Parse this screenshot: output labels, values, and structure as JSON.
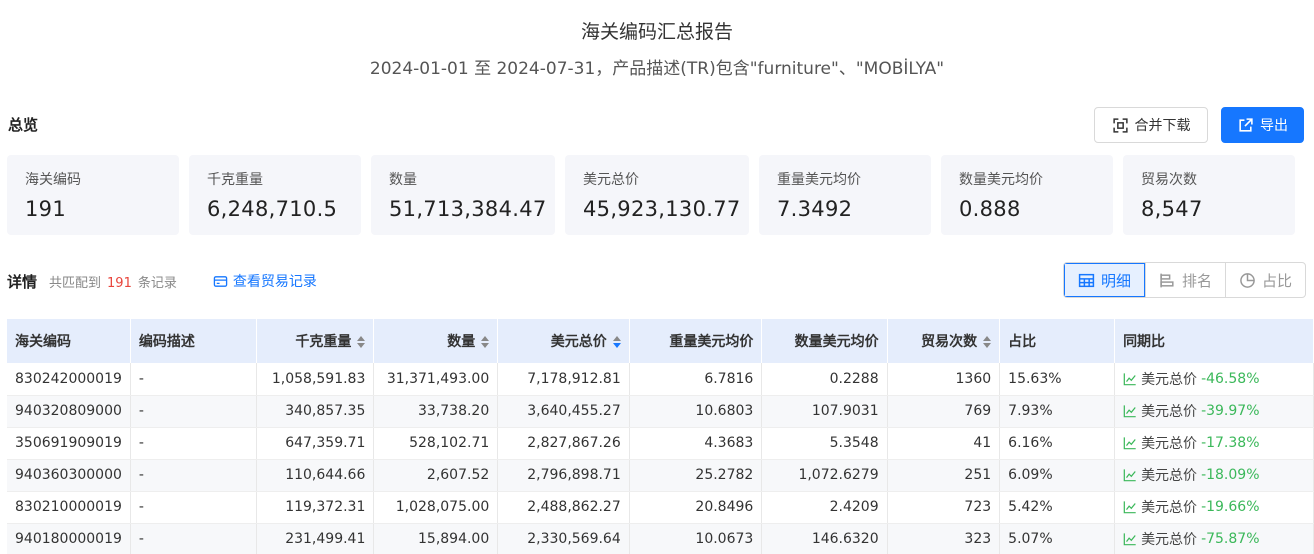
{
  "report": {
    "title": "海关编码汇总报告",
    "subtitle": "2024-01-01 至 2024-07-31，产品描述(TR)包含\"furniture\"、\"MOBİLYA\""
  },
  "overview": {
    "label": "总览",
    "merge_download": "合并下载",
    "export": "导出",
    "cards": [
      {
        "label": "海关编码",
        "value": "191"
      },
      {
        "label": "千克重量",
        "value": "6,248,710.5"
      },
      {
        "label": "数量",
        "value": "51,713,384.47"
      },
      {
        "label": "美元总价",
        "value": "45,923,130.77"
      },
      {
        "label": "重量美元均价",
        "value": "7.3492"
      },
      {
        "label": "数量美元均价",
        "value": "0.888"
      },
      {
        "label": "贸易次数",
        "value": "8,547"
      }
    ]
  },
  "details": {
    "title": "详情",
    "matched_prefix": "共匹配到",
    "matched_count": "191",
    "matched_suffix": "条记录",
    "view_records": "查看贸易记录",
    "views": [
      "明细",
      "排名",
      "占比"
    ],
    "active_view": "明细"
  },
  "table": {
    "columns": [
      "海关编码",
      "编码描述",
      "千克重量",
      "数量",
      "美元总价",
      "重量美元均价",
      "数量美元均价",
      "贸易次数",
      "占比",
      "同期比"
    ],
    "rows": [
      {
        "code": "830242000019",
        "desc": "-",
        "weight": "1,058,591.83",
        "qty": "31,371,493.00",
        "usd": "7,178,912.81",
        "wavg": "6.7816",
        "qavg": "0.2288",
        "trades": "1360",
        "share": "15.63%",
        "yoy_label": "美元总价",
        "yoy": "-46.58%"
      },
      {
        "code": "940320809000",
        "desc": "-",
        "weight": "340,857.35",
        "qty": "33,738.20",
        "usd": "3,640,455.27",
        "wavg": "10.6803",
        "qavg": "107.9031",
        "trades": "769",
        "share": "7.93%",
        "yoy_label": "美元总价",
        "yoy": "-39.97%"
      },
      {
        "code": "350691909019",
        "desc": "-",
        "weight": "647,359.71",
        "qty": "528,102.71",
        "usd": "2,827,867.26",
        "wavg": "4.3683",
        "qavg": "5.3548",
        "trades": "41",
        "share": "6.16%",
        "yoy_label": "美元总价",
        "yoy": "-17.38%"
      },
      {
        "code": "940360300000",
        "desc": "-",
        "weight": "110,644.66",
        "qty": "2,607.52",
        "usd": "2,796,898.71",
        "wavg": "25.2782",
        "qavg": "1,072.6279",
        "trades": "251",
        "share": "6.09%",
        "yoy_label": "美元总价",
        "yoy": "-18.09%"
      },
      {
        "code": "830210000019",
        "desc": "-",
        "weight": "119,372.31",
        "qty": "1,028,075.00",
        "usd": "2,488,862.27",
        "wavg": "20.8496",
        "qavg": "2.4209",
        "trades": "723",
        "share": "5.42%",
        "yoy_label": "美元总价",
        "yoy": "-19.66%"
      },
      {
        "code": "940180000019",
        "desc": "-",
        "weight": "231,499.41",
        "qty": "15,894.00",
        "usd": "2,330,569.64",
        "wavg": "10.0673",
        "qavg": "146.6320",
        "trades": "323",
        "share": "5.07%",
        "yoy_label": "美元总价",
        "yoy": "-75.87%"
      }
    ]
  },
  "colors": {
    "accent": "#1677ff",
    "negative_red": "#e8453c",
    "green": "#3bb85a",
    "header_bg": "#e5edfc"
  }
}
